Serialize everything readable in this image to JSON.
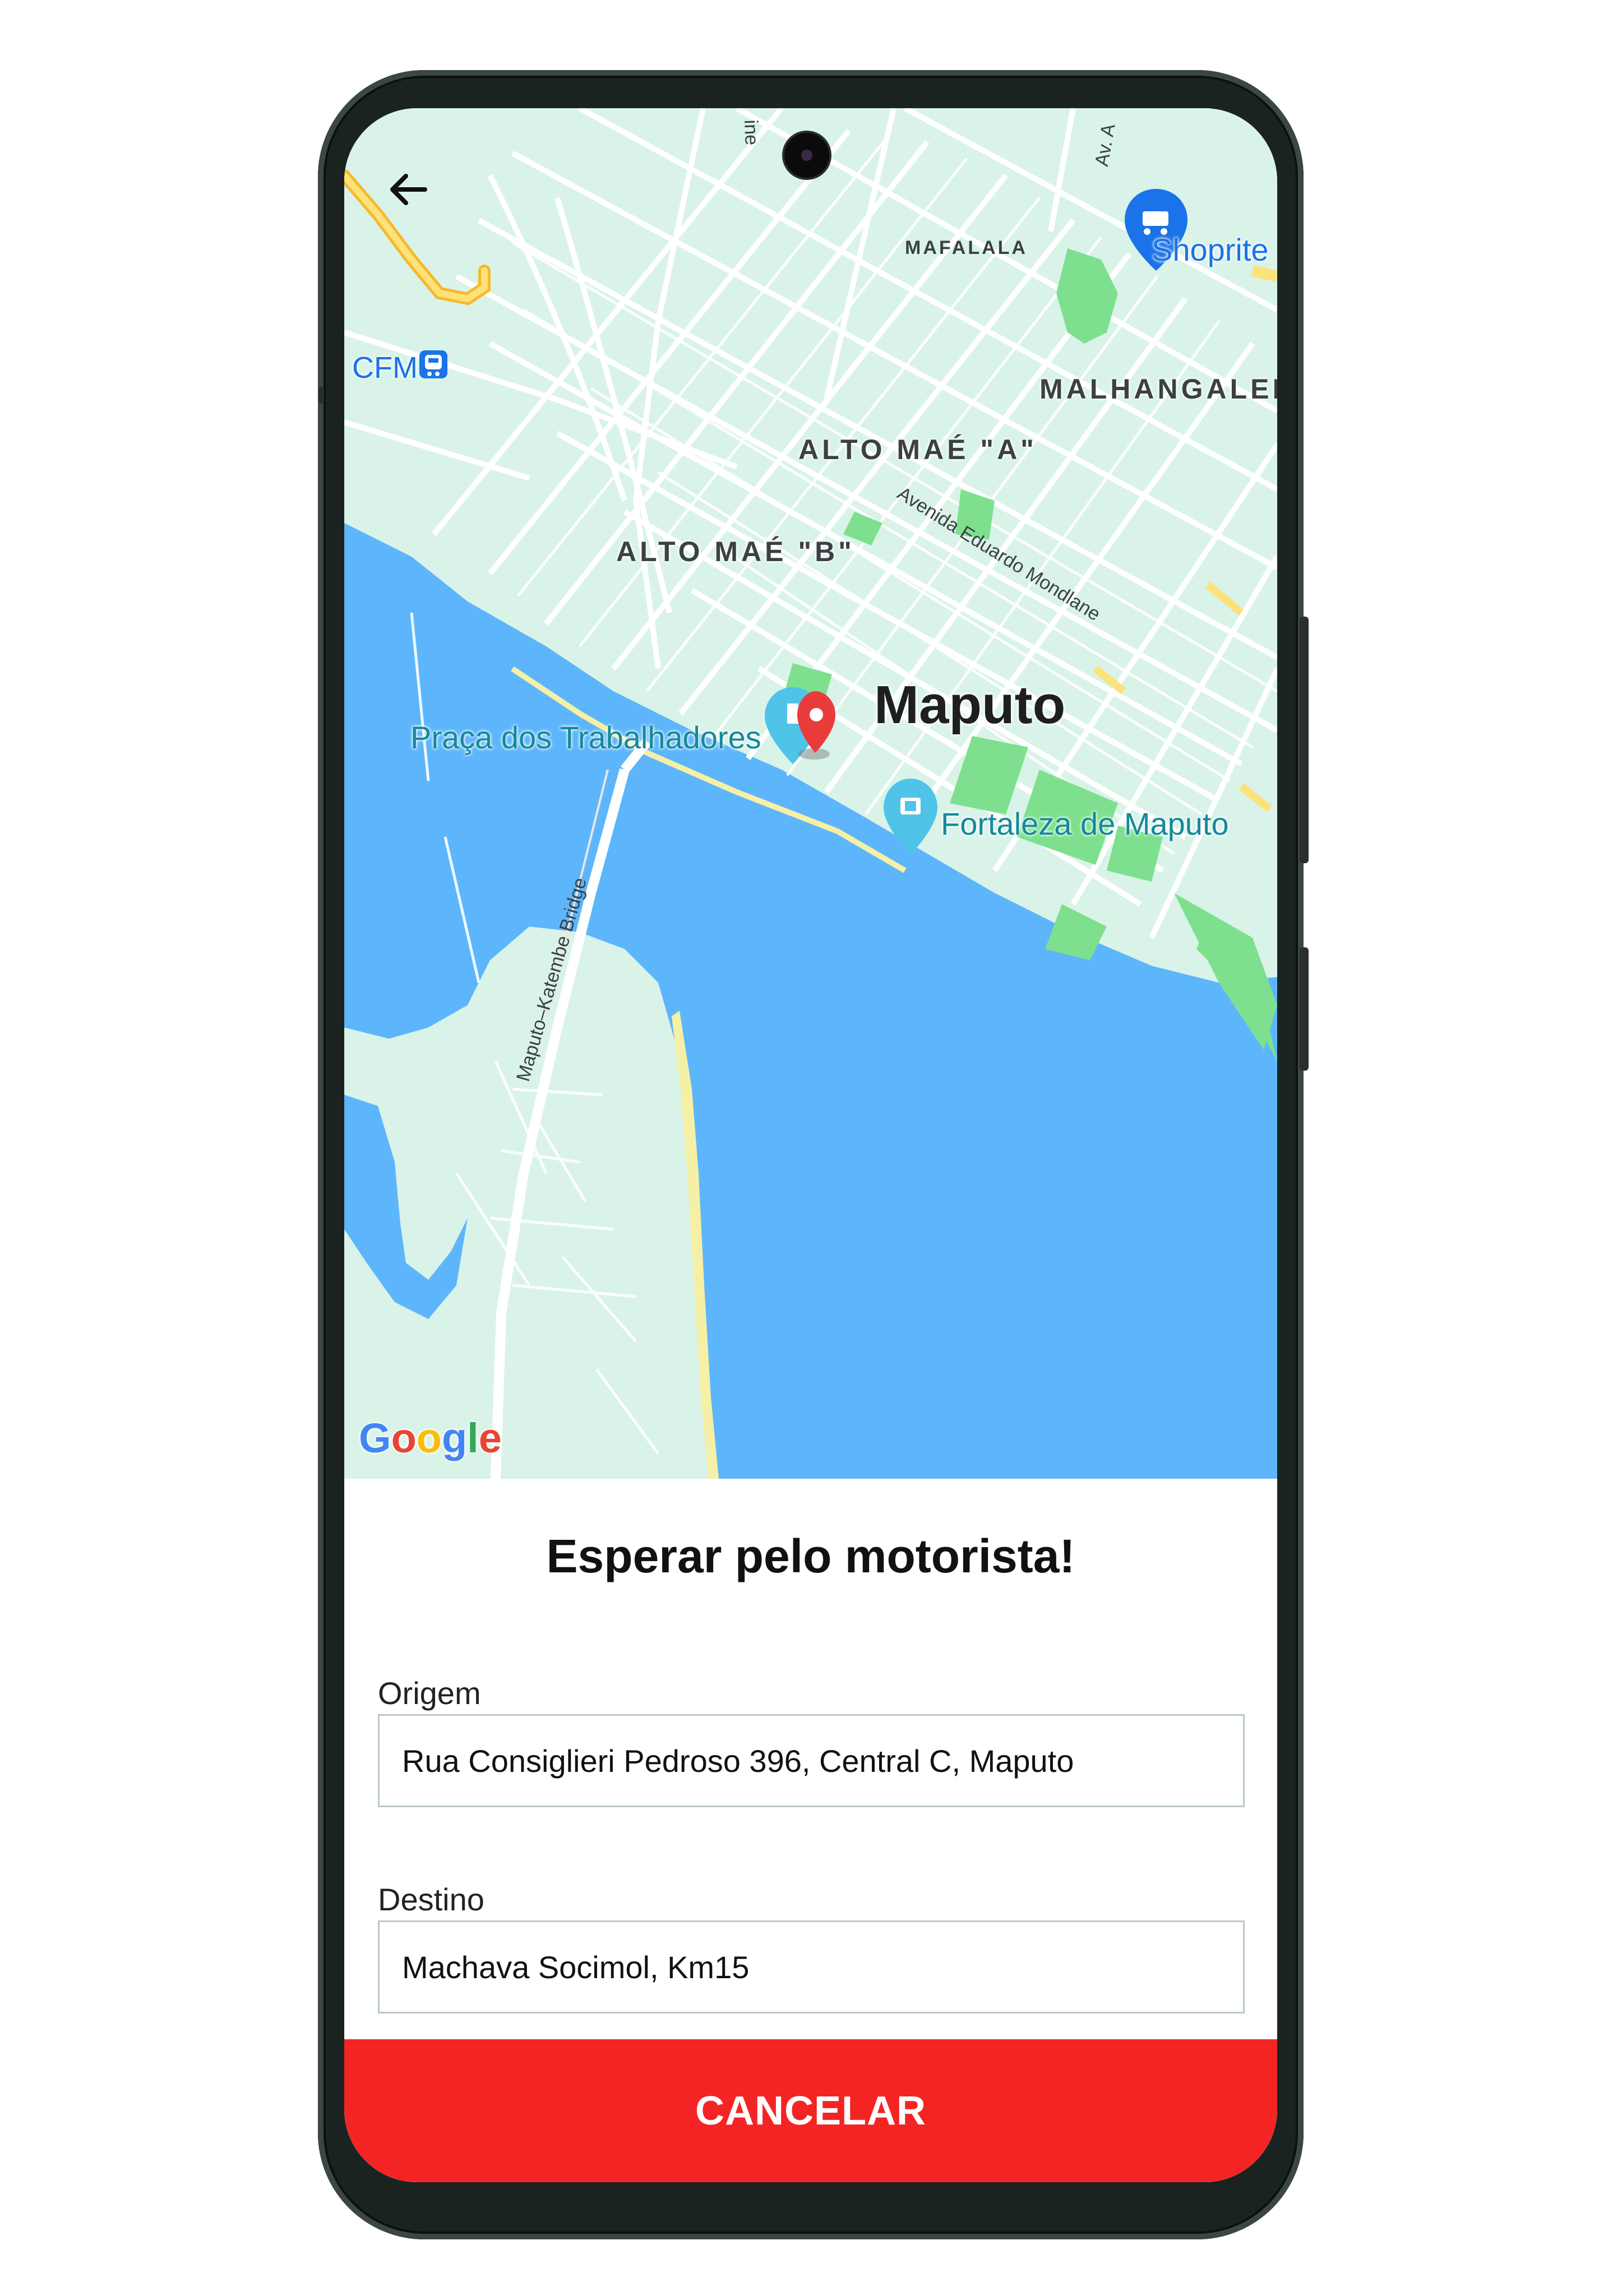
{
  "header": {
    "back_icon": "arrow-left-icon"
  },
  "map": {
    "districts": {
      "mafalala": "MAFALALA",
      "malhangalene": "MALHANGALENE",
      "alto_mae_a": "ALTO MAÉ \"A\"",
      "alto_mae_b": "ALTO MAÉ \"B\""
    },
    "streets": {
      "avenida_mondlane": "Avenida Eduardo Mondlane",
      "bridge": "Maputo–Katembe Bridge",
      "av_top": "Av. A",
      "top_partial": "ine"
    },
    "city": "Maputo",
    "pois": {
      "shoprite": "Shoprite",
      "cfm": "CFM",
      "praca": "Praça dos Trabalhadores",
      "fortaleza": "Fortaleza de Maputo"
    },
    "google_logo": {
      "G": "G",
      "o1": "o",
      "o2": "o",
      "g": "g",
      "l": "l",
      "e": "e"
    },
    "colors": {
      "land": "#d9f3e8",
      "water": "#5db6fb",
      "park": "#7ee08e",
      "road": "#ffffff",
      "highway": "#fbd44a",
      "marker": "#ea3b3b"
    }
  },
  "panel": {
    "title": "Esperar pelo motorista!",
    "origin": {
      "label": "Origem",
      "value": "Rua Consiglieri Pedroso 396, Central C, Maputo"
    },
    "destination": {
      "label": "Destino",
      "value": "Machava Socimol, Km15"
    },
    "cancel_label": "CANCELAR",
    "accent_color": "#f52424"
  }
}
